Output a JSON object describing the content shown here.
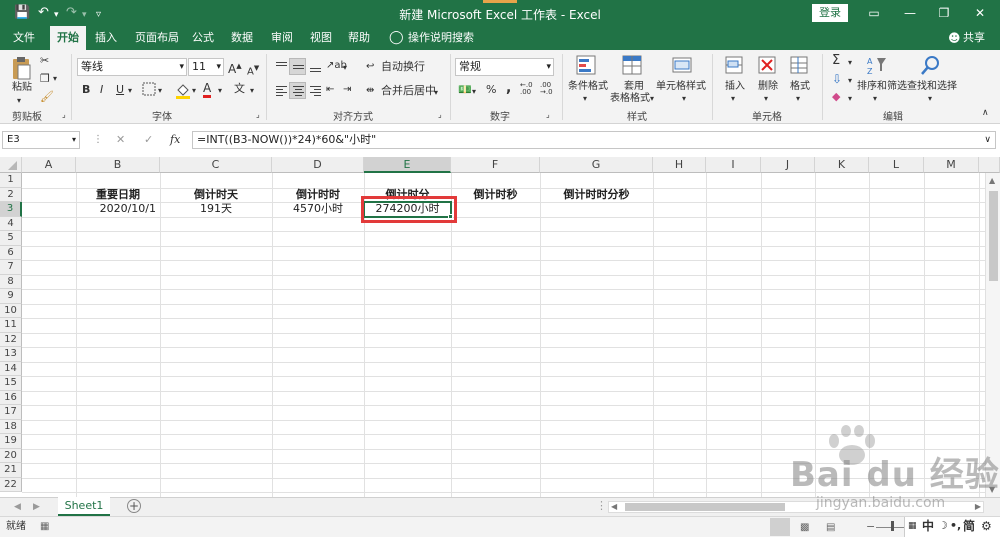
{
  "app": {
    "title": "新建 Microsoft Excel 工作表 - Excel",
    "login": "登录",
    "share": "共享"
  },
  "menu": {
    "tabs": [
      "文件",
      "开始",
      "插入",
      "页面布局",
      "公式",
      "数据",
      "审阅",
      "视图",
      "帮助"
    ],
    "tell_me": "操作说明搜索"
  },
  "ribbon": {
    "clipboard": {
      "paste": "粘贴",
      "label": "剪贴板"
    },
    "font": {
      "name": "等线",
      "size": "11",
      "grow": "A",
      "shrink": "A",
      "bold": "B",
      "italic": "I",
      "underline": "U",
      "font_color_letter": "A",
      "phonetic": "文",
      "label": "字体"
    },
    "alignment": {
      "wrap_text": "自动换行",
      "merge_center": "合并后居中",
      "label": "对齐方式"
    },
    "number": {
      "format": "常规",
      "percent": "%",
      "comma": ",",
      "inc_decimal": "←.0 .00",
      "dec_decimal": ".00 →.0",
      "label": "数字"
    },
    "styles": {
      "conditional": "条件格式",
      "format_table_1": "套用",
      "format_table_2": "表格格式",
      "cell_styles": "单元格样式",
      "label": "样式"
    },
    "cells": {
      "insert": "插入",
      "delete": "删除",
      "format": "格式",
      "label": "单元格"
    },
    "editing": {
      "sum": "Σ",
      "sort_filter": "排序和筛选",
      "find_select": "查找和选择",
      "label": "编辑"
    }
  },
  "formula_bar": {
    "name_box": "E3",
    "cancel": "✕",
    "enter": "✓",
    "fx": "fx",
    "formula": "=INT((B3-NOW())*24)*60&\"小时\""
  },
  "sheet": {
    "columns": [
      "A",
      "B",
      "C",
      "D",
      "E",
      "F",
      "G",
      "H",
      "I",
      "J",
      "K",
      "L",
      "M"
    ],
    "selected_column": "E",
    "selected_row": 3,
    "rows": [
      1,
      2,
      3,
      4,
      5,
      6,
      7,
      8,
      9,
      10,
      11,
      12,
      13,
      14,
      15,
      16,
      17,
      18,
      19,
      20,
      21,
      22
    ],
    "headers": {
      "B2": "重要日期",
      "C2": "倒计时天",
      "D2": "倒计时时",
      "E2": "倒计时分",
      "F2": "倒计时秒",
      "G2": "倒计时时分秒"
    },
    "values": {
      "B3": "2020/10/1",
      "C3": "191天",
      "D3": "4570小时",
      "E3": "274200小时"
    }
  },
  "tabs": {
    "sheet_name": "Sheet1",
    "add": "+"
  },
  "status": {
    "ready": "就绪",
    "ime": "中",
    "ime_mode": "简"
  },
  "watermark": {
    "brand": "Bai du 经验",
    "url": "jingyan.baidu.com"
  },
  "colors": {
    "excel_green": "#217346",
    "highlight_red": "#e23a3a"
  }
}
